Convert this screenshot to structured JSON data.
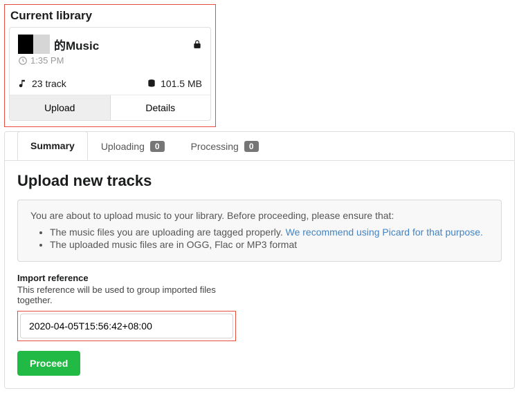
{
  "library": {
    "section_title": "Current library",
    "name": "的Music",
    "time": "1:35 PM",
    "tracks_label": "23 track",
    "size_label": "101.5 MB",
    "upload_label": "Upload",
    "details_label": "Details"
  },
  "tabs": {
    "summary": "Summary",
    "uploading": "Uploading",
    "uploading_count": "0",
    "processing": "Processing",
    "processing_count": "0"
  },
  "upload": {
    "heading": "Upload new tracks",
    "intro": "You are about to upload music to your library. Before proceeding, please ensure that:",
    "bullet1a": "The music files you are uploading are tagged properly.  ",
    "bullet1b": "We recommend using Picard for that purpose.",
    "bullet2": "The uploaded music files are in OGG, Flac or MP3 format",
    "ref_label": "Import reference",
    "ref_help": "This reference will be used to group imported files together.",
    "ref_value": "2020-04-05T15:56:42+08:00",
    "proceed": "Proceed"
  }
}
